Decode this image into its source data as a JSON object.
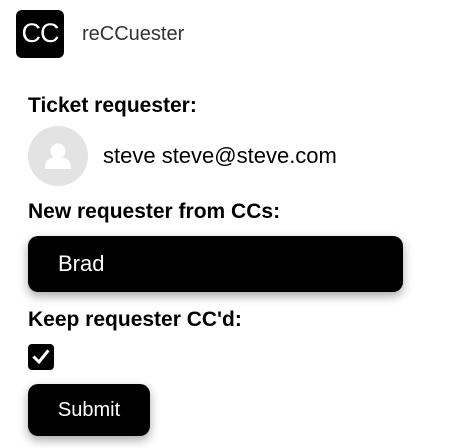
{
  "app": {
    "logo_text": "CC",
    "name": "reCCuester"
  },
  "ticket_requester": {
    "label": "Ticket requester:",
    "name": "steve",
    "email": "steve@steve.com",
    "display": "steve steve@steve.com",
    "avatar_icon": "user-avatar-icon"
  },
  "new_requester": {
    "label": "New requester from CCs:",
    "selected": "Brad"
  },
  "keep_cc": {
    "label": "Keep requester CC'd:",
    "checked": true,
    "check_icon": "checkmark-icon"
  },
  "submit": {
    "label": "Submit"
  },
  "colors": {
    "primary": "#000000",
    "background": "#ffffff",
    "avatar_bg": "#e3e3e3",
    "avatar_fg": "#ffffff"
  }
}
